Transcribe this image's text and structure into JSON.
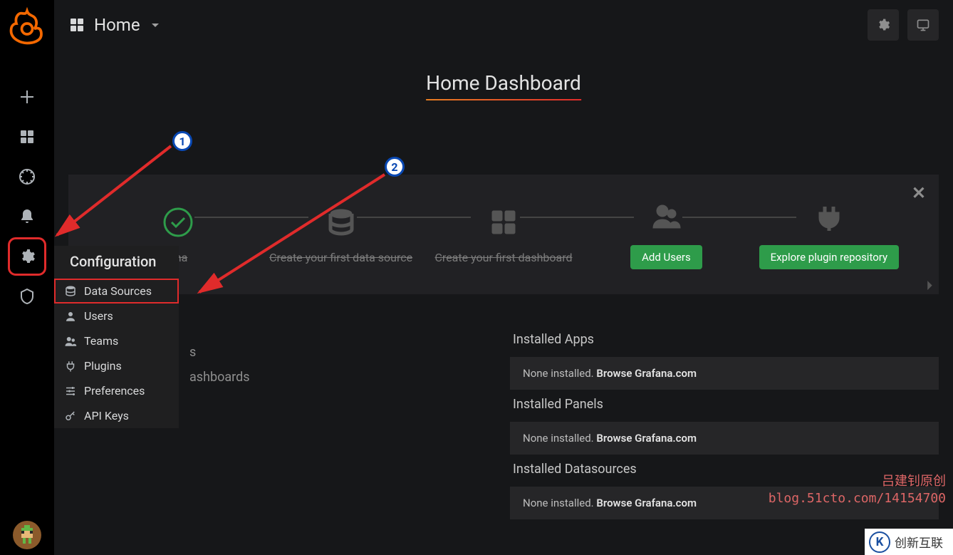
{
  "nav": {
    "title": "Home",
    "settings_tooltip": "Dashboard settings",
    "view_tooltip": "Cycle view mode"
  },
  "page": {
    "title": "Home Dashboard"
  },
  "steps": {
    "items": [
      {
        "label_suffix": "ana",
        "done": true,
        "button": null
      },
      {
        "label": "Create your first data source",
        "done": false,
        "button": null,
        "strike": true
      },
      {
        "label": "Create your first dashboard",
        "done": false,
        "button": null,
        "strike": true
      },
      {
        "label": null,
        "button": "Add Users"
      },
      {
        "label": null,
        "button": "Explore plugin repository"
      }
    ]
  },
  "left_panel": {
    "line1_suffix": "s",
    "line2_suffix": "ashboards"
  },
  "right_panel": {
    "sections": [
      {
        "title": "Installed Apps",
        "none": "None installed.",
        "browse": "Browse Grafana.com"
      },
      {
        "title": "Installed Panels",
        "none": "None installed.",
        "browse": "Browse Grafana.com"
      },
      {
        "title": "Installed Datasources",
        "none": "None installed.",
        "browse": "Browse Grafana.com"
      }
    ]
  },
  "flyout": {
    "title": "Configuration",
    "items": [
      {
        "label": "Data Sources",
        "highlighted": true
      },
      {
        "label": "Users"
      },
      {
        "label": "Teams"
      },
      {
        "label": "Plugins"
      },
      {
        "label": "Preferences"
      },
      {
        "label": "API Keys"
      }
    ]
  },
  "annotations": {
    "circle1": "1",
    "circle2": "2"
  },
  "watermark": {
    "line1": "吕建钊原创",
    "line2": "blog.51cto.com/14154700",
    "brand": "创新互联"
  }
}
